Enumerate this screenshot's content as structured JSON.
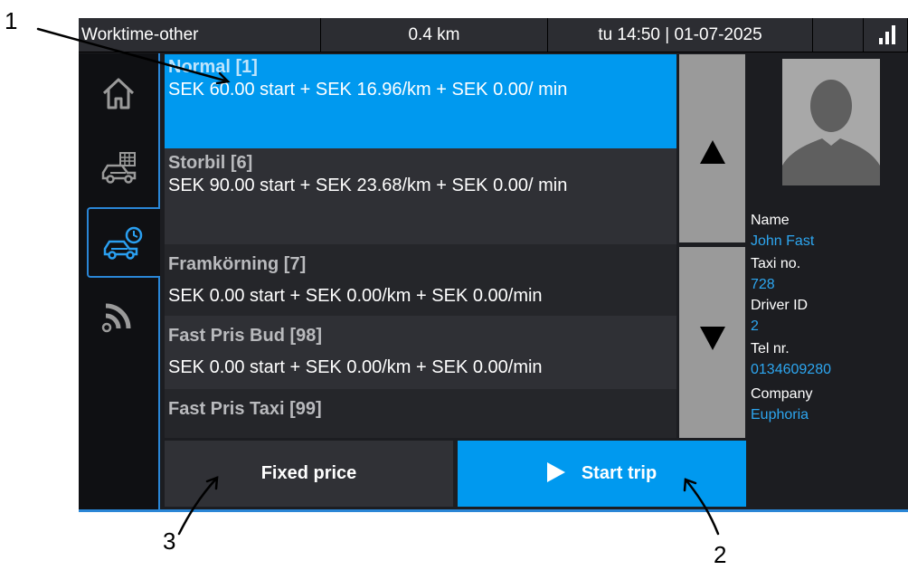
{
  "status_bar": {
    "mode": "Worktime-other",
    "distance": "0.4 km",
    "datetime": "tu 14:50 | 01-07-2025",
    "signal_icon": "signal-bars-icon"
  },
  "sidebar": {
    "items": [
      {
        "name": "home",
        "icon": "home-icon"
      },
      {
        "name": "taxi-meter",
        "icon": "taxi-meter-icon"
      },
      {
        "name": "taxi-time",
        "icon": "taxi-clock-icon",
        "active": true
      },
      {
        "name": "connection",
        "icon": "wifi-signal-icon"
      }
    ]
  },
  "tariffs": [
    {
      "title": "Normal [1]",
      "description": "SEK 60.00 start + SEK 16.96/km + SEK 0.00/ min",
      "selected": true
    },
    {
      "title": "Storbil [6]",
      "description": "SEK 90.00 start + SEK 23.68/km + SEK 0.00/ min"
    },
    {
      "title": "Framkörning [7]",
      "description": "SEK 0.00 start + SEK 0.00/km + SEK 0.00/min"
    },
    {
      "title": "Fast Pris Bud [98]",
      "description": "SEK 0.00 start + SEK 0.00/km + SEK 0.00/min"
    },
    {
      "title": "Fast Pris Taxi [99]",
      "description": ""
    }
  ],
  "buttons": {
    "fixed_price": "Fixed price",
    "start_trip": "Start trip"
  },
  "driver": {
    "name_label": "Name",
    "name": "John Fast",
    "taxi_label": "Taxi no.",
    "taxi_no": "728",
    "driver_id_label": "Driver ID",
    "driver_id": "2",
    "tel_label": "Tel nr.",
    "tel": "0134609280",
    "company_label": "Company",
    "company": "Euphoria"
  },
  "callouts": [
    "1",
    "2",
    "3"
  ],
  "colors": {
    "accent": "#0099ef",
    "value_text": "#2da6f0",
    "background": "#1c1d21"
  }
}
